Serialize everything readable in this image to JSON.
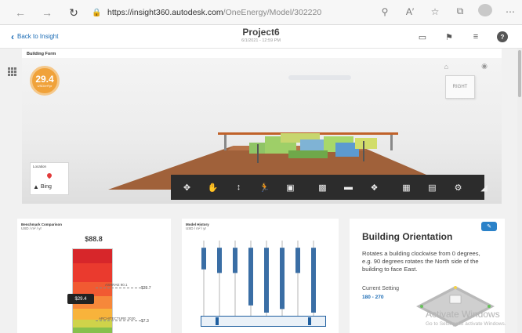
{
  "browser": {
    "url_host": "https://insight360.autodesk.com",
    "url_path": "/OneEnergy/Model/302220",
    "icons": [
      "back-icon",
      "forward-icon",
      "refresh-icon",
      "lock-icon",
      "zoom-icon",
      "read-aloud-icon",
      "favorite-icon",
      "collections-icon",
      "profile-icon",
      "more-icon"
    ]
  },
  "header": {
    "back_label": "Back to Insight",
    "project_title": "Project6",
    "project_date": "6/1/2021 - 12:59 PM"
  },
  "building_form": {
    "label": "Building Form",
    "score_value": "29.4",
    "score_unit": "USD/m²/yr",
    "viewcube_label": "RIGHT",
    "location_label": "Location",
    "bing_label": "Bing"
  },
  "benchmark": {
    "title": "Benchmark Comparison",
    "unit": "USD / m² / yr",
    "top_value": "$88.8",
    "current_marker": "$29.4",
    "ashrae_label": "ASHRAE 90.1",
    "ashrae_value": "$39.7",
    "arch_label": "ARCHITECTURE 2030",
    "arch_value": "$7.3"
  },
  "model_history": {
    "title": "Model History",
    "unit": "USD / m² / yr"
  },
  "chart_data": {
    "type": "bar",
    "title": "Model History",
    "ylabel": "USD / m² / yr",
    "series": [
      {
        "values": [
          [
            60,
            90
          ],
          [
            55,
            90
          ],
          [
            55,
            90
          ],
          [
            10,
            90
          ],
          [
            0,
            90
          ],
          [
            5,
            90
          ],
          [
            55,
            90
          ],
          [
            0,
            90
          ]
        ]
      }
    ],
    "ylim": [
      0,
      100
    ]
  },
  "orientation": {
    "title": "Building Orientation",
    "description": "Rotates a building clockwise from 0 degrees, e.g. 90 degrees rotates the North side of the building to face East.",
    "current_setting_label": "Current Setting",
    "current_setting_value": "180 - 270"
  },
  "watermark": {
    "line1": "Activate Windows",
    "line2": "Go to Settings to activate Windows."
  },
  "colors": {
    "accent": "#1a6bb5",
    "score": "#f0a23a",
    "toolbar": "#2c2c2c",
    "bar": "#3a6ea5"
  }
}
